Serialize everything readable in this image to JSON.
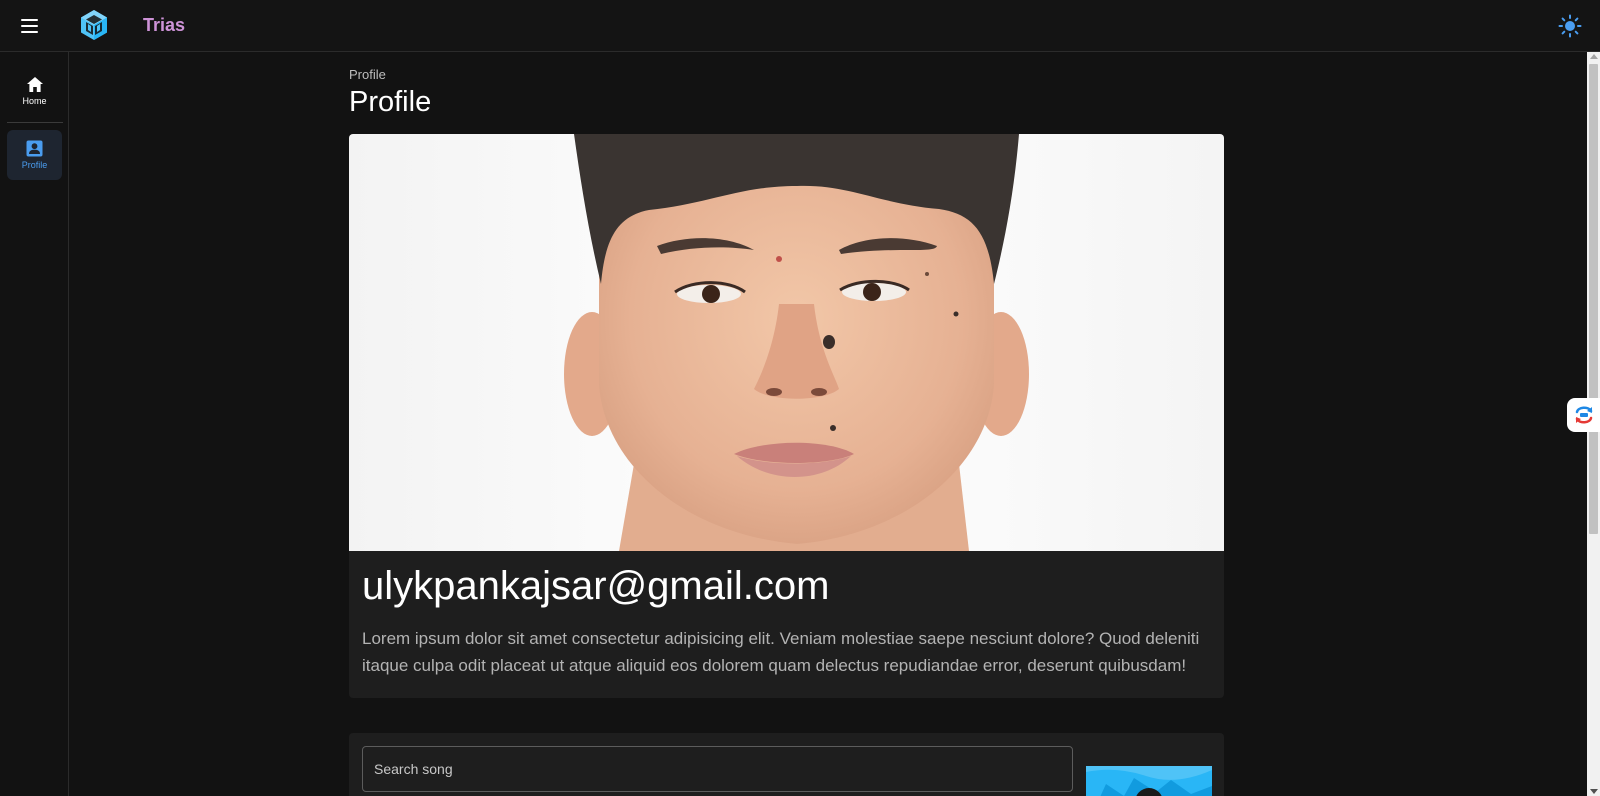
{
  "app": {
    "title": "Trias"
  },
  "header": {
    "menu_icon": "hamburger-menu-icon",
    "logo_icon": "cube-logo-icon",
    "theme_icon": "sun-icon"
  },
  "nav": {
    "items": [
      {
        "label": "Home",
        "icon": "home-icon",
        "active": false
      },
      {
        "label": "Profile",
        "icon": "profile-badge-icon",
        "active": true
      }
    ]
  },
  "page": {
    "breadcrumb": "Profile",
    "title": "Profile"
  },
  "profile": {
    "email": "ulykpankajsar@gmail.com",
    "bio": "Lorem ipsum dolor sit amet consectetur adipisicing elit. Veniam molestiae saepe nesciunt dolore? Quod deleniti itaque culpa odit placeat ut atque aliquid eos dolorem quam delectus repudiandae error, deserunt quibusdam!"
  },
  "search": {
    "placeholder": "Search song",
    "value": ""
  },
  "colors": {
    "background": "#121212",
    "card": "#1e1e1e",
    "brand_title": "#ce93d8",
    "accent": "#4a9df0",
    "logo": "#4fc3f7"
  }
}
